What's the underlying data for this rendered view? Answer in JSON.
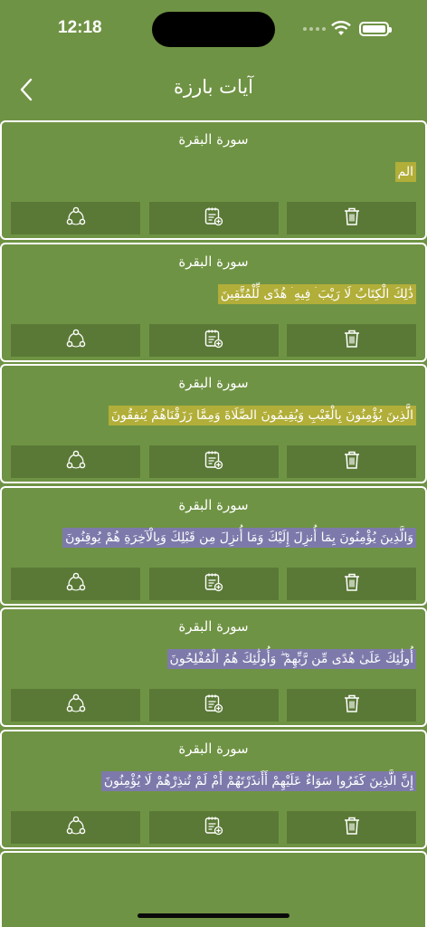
{
  "status": {
    "time": "12:18"
  },
  "nav": {
    "title": "آيات بارزة"
  },
  "colors": {
    "background": "#6f9344",
    "highlight_yellow": "#b1ae39",
    "highlight_purple": "#7d7aab",
    "button_bg": "#5a7936"
  },
  "cards": [
    {
      "sura": "سورة البقرة",
      "ayah": "الم",
      "highlight": "yellow"
    },
    {
      "sura": "سورة البقرة",
      "ayah": "ذَٰلِكَ الْكِتَابُ لَا رَيْبَ ۛ فِيهِ ۛ هُدًى لِّلْمُتَّقِينَ",
      "highlight": "yellow"
    },
    {
      "sura": "سورة البقرة",
      "ayah": "الَّذِينَ يُؤْمِنُونَ بِالْغَيْبِ وَيُقِيمُونَ الصَّلَاةَ وَمِمَّا رَزَقْنَاهُمْ يُنفِقُونَ",
      "highlight": "yellow"
    },
    {
      "sura": "سورة البقرة",
      "ayah": "وَالَّذِينَ يُؤْمِنُونَ بِمَا أُنزِلَ إِلَيْكَ وَمَا أُنزِلَ مِن قَبْلِكَ وَبِالْآخِرَةِ هُمْ يُوقِنُونَ",
      "highlight": "purple"
    },
    {
      "sura": "سورة البقرة",
      "ayah": "أُولَٰئِكَ عَلَىٰ هُدًى مِّن رَّبِّهِمْ ۖ وَأُولَٰئِكَ هُمُ الْمُفْلِحُونَ",
      "highlight": "purple"
    },
    {
      "sura": "سورة البقرة",
      "ayah": "إِنَّ الَّذِينَ كَفَرُوا سَوَاءٌ عَلَيْهِمْ أَأَنذَرْتَهُمْ أَمْ لَمْ تُنذِرْهُمْ لَا يُؤْمِنُونَ",
      "highlight": "purple"
    }
  ],
  "icons": {
    "share": "share-icon",
    "note": "add-note-icon",
    "delete": "trash-icon"
  }
}
